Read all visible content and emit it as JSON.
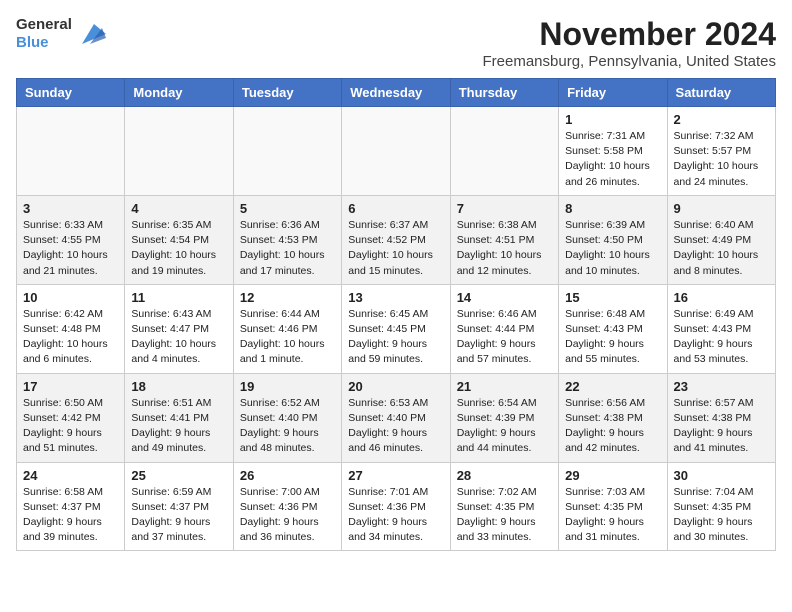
{
  "header": {
    "logo_line1": "General",
    "logo_line2": "Blue",
    "title": "November 2024",
    "subtitle": "Freemansburg, Pennsylvania, United States"
  },
  "days_of_week": [
    "Sunday",
    "Monday",
    "Tuesday",
    "Wednesday",
    "Thursday",
    "Friday",
    "Saturday"
  ],
  "weeks": [
    [
      {
        "day": "",
        "info": ""
      },
      {
        "day": "",
        "info": ""
      },
      {
        "day": "",
        "info": ""
      },
      {
        "day": "",
        "info": ""
      },
      {
        "day": "",
        "info": ""
      },
      {
        "day": "1",
        "info": "Sunrise: 7:31 AM\nSunset: 5:58 PM\nDaylight: 10 hours\nand 26 minutes."
      },
      {
        "day": "2",
        "info": "Sunrise: 7:32 AM\nSunset: 5:57 PM\nDaylight: 10 hours\nand 24 minutes."
      }
    ],
    [
      {
        "day": "3",
        "info": "Sunrise: 6:33 AM\nSunset: 4:55 PM\nDaylight: 10 hours\nand 21 minutes."
      },
      {
        "day": "4",
        "info": "Sunrise: 6:35 AM\nSunset: 4:54 PM\nDaylight: 10 hours\nand 19 minutes."
      },
      {
        "day": "5",
        "info": "Sunrise: 6:36 AM\nSunset: 4:53 PM\nDaylight: 10 hours\nand 17 minutes."
      },
      {
        "day": "6",
        "info": "Sunrise: 6:37 AM\nSunset: 4:52 PM\nDaylight: 10 hours\nand 15 minutes."
      },
      {
        "day": "7",
        "info": "Sunrise: 6:38 AM\nSunset: 4:51 PM\nDaylight: 10 hours\nand 12 minutes."
      },
      {
        "day": "8",
        "info": "Sunrise: 6:39 AM\nSunset: 4:50 PM\nDaylight: 10 hours\nand 10 minutes."
      },
      {
        "day": "9",
        "info": "Sunrise: 6:40 AM\nSunset: 4:49 PM\nDaylight: 10 hours\nand 8 minutes."
      }
    ],
    [
      {
        "day": "10",
        "info": "Sunrise: 6:42 AM\nSunset: 4:48 PM\nDaylight: 10 hours\nand 6 minutes."
      },
      {
        "day": "11",
        "info": "Sunrise: 6:43 AM\nSunset: 4:47 PM\nDaylight: 10 hours\nand 4 minutes."
      },
      {
        "day": "12",
        "info": "Sunrise: 6:44 AM\nSunset: 4:46 PM\nDaylight: 10 hours\nand 1 minute."
      },
      {
        "day": "13",
        "info": "Sunrise: 6:45 AM\nSunset: 4:45 PM\nDaylight: 9 hours\nand 59 minutes."
      },
      {
        "day": "14",
        "info": "Sunrise: 6:46 AM\nSunset: 4:44 PM\nDaylight: 9 hours\nand 57 minutes."
      },
      {
        "day": "15",
        "info": "Sunrise: 6:48 AM\nSunset: 4:43 PM\nDaylight: 9 hours\nand 55 minutes."
      },
      {
        "day": "16",
        "info": "Sunrise: 6:49 AM\nSunset: 4:43 PM\nDaylight: 9 hours\nand 53 minutes."
      }
    ],
    [
      {
        "day": "17",
        "info": "Sunrise: 6:50 AM\nSunset: 4:42 PM\nDaylight: 9 hours\nand 51 minutes."
      },
      {
        "day": "18",
        "info": "Sunrise: 6:51 AM\nSunset: 4:41 PM\nDaylight: 9 hours\nand 49 minutes."
      },
      {
        "day": "19",
        "info": "Sunrise: 6:52 AM\nSunset: 4:40 PM\nDaylight: 9 hours\nand 48 minutes."
      },
      {
        "day": "20",
        "info": "Sunrise: 6:53 AM\nSunset: 4:40 PM\nDaylight: 9 hours\nand 46 minutes."
      },
      {
        "day": "21",
        "info": "Sunrise: 6:54 AM\nSunset: 4:39 PM\nDaylight: 9 hours\nand 44 minutes."
      },
      {
        "day": "22",
        "info": "Sunrise: 6:56 AM\nSunset: 4:38 PM\nDaylight: 9 hours\nand 42 minutes."
      },
      {
        "day": "23",
        "info": "Sunrise: 6:57 AM\nSunset: 4:38 PM\nDaylight: 9 hours\nand 41 minutes."
      }
    ],
    [
      {
        "day": "24",
        "info": "Sunrise: 6:58 AM\nSunset: 4:37 PM\nDaylight: 9 hours\nand 39 minutes."
      },
      {
        "day": "25",
        "info": "Sunrise: 6:59 AM\nSunset: 4:37 PM\nDaylight: 9 hours\nand 37 minutes."
      },
      {
        "day": "26",
        "info": "Sunrise: 7:00 AM\nSunset: 4:36 PM\nDaylight: 9 hours\nand 36 minutes."
      },
      {
        "day": "27",
        "info": "Sunrise: 7:01 AM\nSunset: 4:36 PM\nDaylight: 9 hours\nand 34 minutes."
      },
      {
        "day": "28",
        "info": "Sunrise: 7:02 AM\nSunset: 4:35 PM\nDaylight: 9 hours\nand 33 minutes."
      },
      {
        "day": "29",
        "info": "Sunrise: 7:03 AM\nSunset: 4:35 PM\nDaylight: 9 hours\nand 31 minutes."
      },
      {
        "day": "30",
        "info": "Sunrise: 7:04 AM\nSunset: 4:35 PM\nDaylight: 9 hours\nand 30 minutes."
      }
    ]
  ]
}
